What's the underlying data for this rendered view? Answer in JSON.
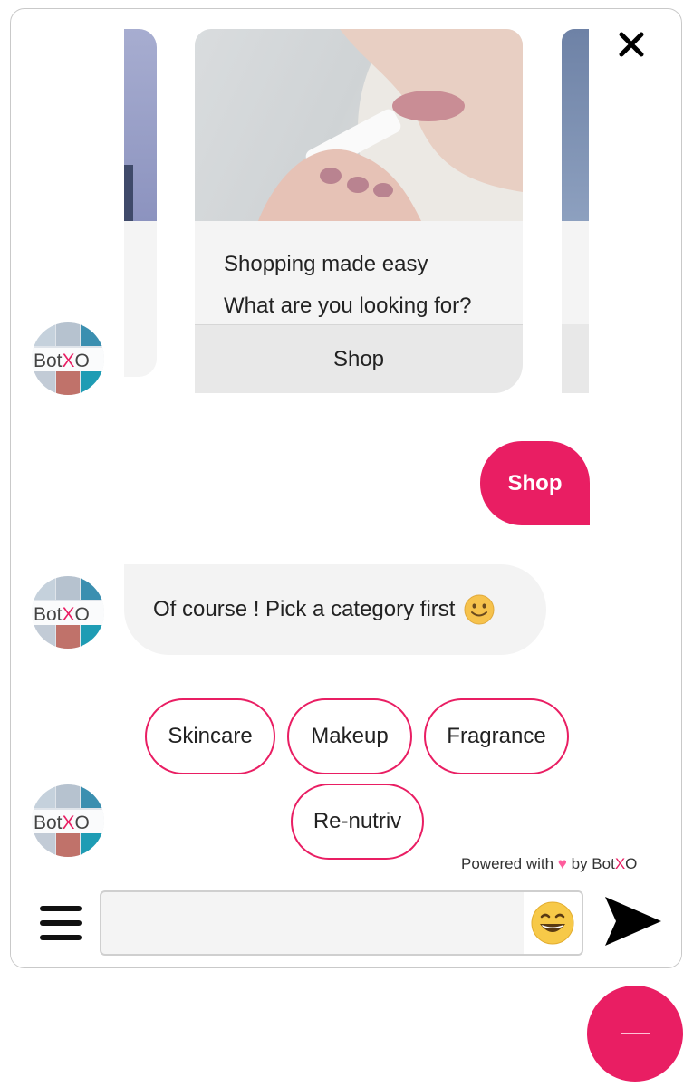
{
  "carousel": {
    "card": {
      "title": "Shopping made easy",
      "subtitle": "What are you looking for?",
      "button_label": "Shop"
    }
  },
  "messages": {
    "user_reply": "Shop",
    "bot_reply": "Of course ! Pick a category first"
  },
  "quick_replies": [
    "Skincare",
    "Makeup",
    "Fragrance",
    "Re-nutriv"
  ],
  "footer": {
    "powered_prefix": "Powered with",
    "powered_by": "by Bot",
    "brand_x": "X",
    "brand_o": "O"
  },
  "avatar": {
    "brand_prefix": "Bot",
    "brand_x": "X",
    "brand_o": "O"
  },
  "composer": {
    "placeholder": ""
  },
  "icons": {
    "close": "close-icon",
    "menu": "hamburger-menu-icon",
    "emoji": "grinning-face-icon",
    "send": "send-icon",
    "smile": "slightly-smiling-face-icon",
    "heart": "heart-icon",
    "fab": "minimize-icon"
  },
  "colors": {
    "accent": "#e91e63",
    "bubble_bot": "#f3f3f3",
    "card_bg": "#f4f4f4"
  }
}
